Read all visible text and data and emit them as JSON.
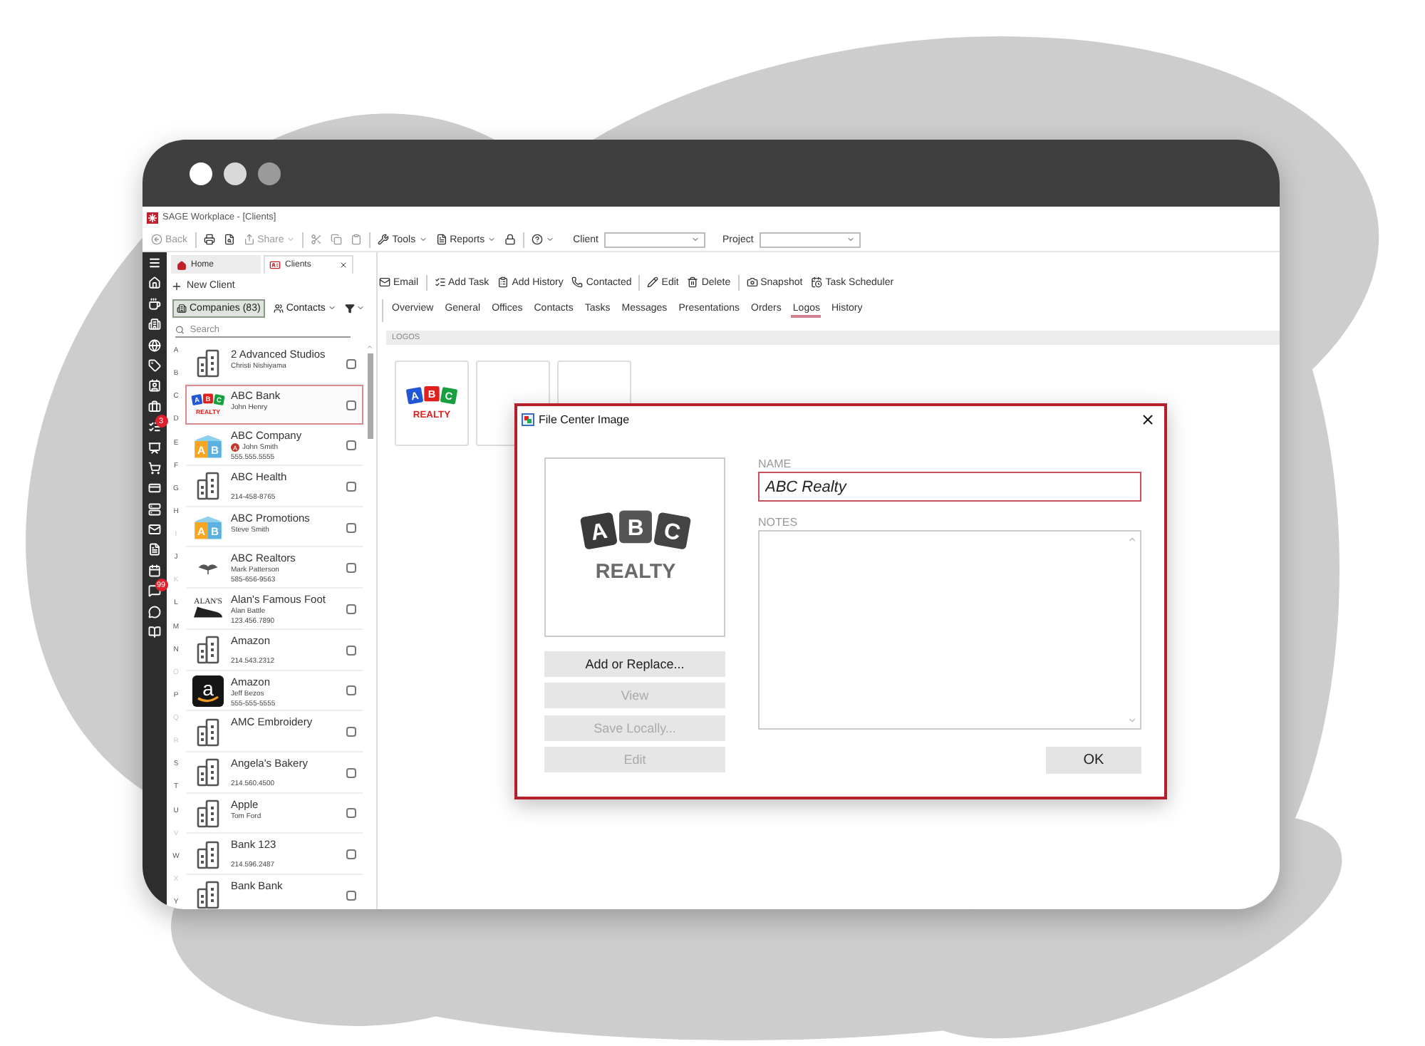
{
  "app": {
    "title": "SAGE Workplace - [Clients]"
  },
  "toolbar": [
    {
      "kind": "back",
      "label": "Back",
      "disabled": true
    },
    {
      "kind": "separator"
    },
    {
      "kind": "print",
      "disabled": false
    },
    {
      "kind": "preview",
      "disabled": false
    },
    {
      "kind": "share",
      "label": "Share",
      "caret": true,
      "disabled": true
    },
    {
      "kind": "separator"
    },
    {
      "kind": "cut",
      "disabled": true
    },
    {
      "kind": "copy",
      "disabled": true
    },
    {
      "kind": "paste",
      "disabled": true
    },
    {
      "kind": "separator"
    },
    {
      "kind": "tools",
      "label": "Tools",
      "caret": true,
      "disabled": false
    },
    {
      "kind": "reports",
      "label": "Reports",
      "caret": true,
      "disabled": false
    },
    {
      "kind": "lock",
      "disabled": false
    },
    {
      "kind": "separator"
    },
    {
      "kind": "help",
      "caret": true,
      "disabled": false
    }
  ],
  "filters": [
    {
      "label": "Client"
    },
    {
      "label": "Project"
    }
  ],
  "rail": [
    {
      "kind": "menu"
    },
    {
      "kind": "home"
    },
    {
      "kind": "cup"
    },
    {
      "kind": "building"
    },
    {
      "kind": "globe"
    },
    {
      "kind": "tag"
    },
    {
      "kind": "contact"
    },
    {
      "kind": "briefcase"
    },
    {
      "kind": "tasks",
      "badge": "3"
    },
    {
      "kind": "presentation"
    },
    {
      "kind": "cart"
    },
    {
      "kind": "card"
    },
    {
      "kind": "server"
    },
    {
      "kind": "mail"
    },
    {
      "kind": "file"
    },
    {
      "kind": "calendar"
    },
    {
      "kind": "messages",
      "badge": "99"
    },
    {
      "kind": "chat"
    },
    {
      "kind": "book"
    }
  ],
  "doc_tabs": [
    {
      "label": "Home",
      "kind": "home",
      "selected": false,
      "closable": false
    },
    {
      "label": "Clients",
      "kind": "clients",
      "selected": true,
      "closable": true
    }
  ],
  "list_pane": {
    "new_client": "New Client",
    "views": [
      {
        "label": "Companies (83)",
        "kind": "building",
        "caret": false,
        "selected": true
      },
      {
        "label": "Contacts",
        "kind": "users",
        "caret": true,
        "selected": false
      }
    ],
    "search": {
      "placeholder": "Search"
    },
    "index_letters": [
      {
        "letter": "A",
        "disabled": false
      },
      {
        "letter": "B",
        "disabled": false
      },
      {
        "letter": "C",
        "disabled": false
      },
      {
        "letter": "D",
        "disabled": false
      },
      {
        "letter": "E",
        "disabled": false
      },
      {
        "letter": "F",
        "disabled": false
      },
      {
        "letter": "G",
        "disabled": false
      },
      {
        "letter": "H",
        "disabled": false
      },
      {
        "letter": "I",
        "disabled": true
      },
      {
        "letter": "J",
        "disabled": false
      },
      {
        "letter": "K",
        "disabled": true
      },
      {
        "letter": "L",
        "disabled": false
      },
      {
        "letter": "M",
        "disabled": false
      },
      {
        "letter": "N",
        "disabled": false
      },
      {
        "letter": "O",
        "disabled": true
      },
      {
        "letter": "P",
        "disabled": false
      },
      {
        "letter": "Q",
        "disabled": true
      },
      {
        "letter": "R",
        "disabled": true
      },
      {
        "letter": "S",
        "disabled": false
      },
      {
        "letter": "T",
        "disabled": false
      },
      {
        "letter": "U",
        "disabled": false
      },
      {
        "letter": "V",
        "disabled": true
      },
      {
        "letter": "W",
        "disabled": false
      },
      {
        "letter": "X",
        "disabled": true
      },
      {
        "letter": "Y",
        "disabled": false
      }
    ],
    "clients": [
      {
        "name": "2 Advanced Studios",
        "contact": "Christi Nishiyama",
        "logo": {
          "kind": "building"
        },
        "selected": false,
        "checked": false
      },
      {
        "name": "ABC Bank",
        "contact": "John Henry",
        "logo": {
          "kind": "blocks-color",
          "letters": [
            "A",
            "B",
            "C"
          ],
          "caption": "REALTY"
        },
        "selected": true,
        "checked": false
      },
      {
        "name": "ABC Company",
        "contact": "John Smith",
        "badge": "A",
        "phone": "555.555.5555",
        "logo": {
          "kind": "toy-blocks",
          "letters": [
            "A",
            "B"
          ]
        },
        "selected": false,
        "checked": false
      },
      {
        "name": "ABC Health",
        "phone": "214-458-8765",
        "logo": {
          "kind": "building"
        },
        "selected": false,
        "checked": false
      },
      {
        "name": "ABC Promotions",
        "contact": "Steve Smith",
        "logo": {
          "kind": "toy-blocks",
          "letters": [
            "A",
            "B"
          ]
        },
        "selected": false,
        "checked": false
      },
      {
        "name": "ABC Realtors",
        "contact": "Mark Patterson",
        "phone": "585-656-9563",
        "logo": {
          "kind": "bird"
        },
        "selected": false,
        "checked": false
      },
      {
        "name": "Alan's Famous Foot",
        "contact": "Alan Battle",
        "phone": "123.456.7890",
        "logo": {
          "kind": "shoe",
          "caption": "ALAN'S"
        },
        "selected": false,
        "checked": false
      },
      {
        "name": "Amazon",
        "phone": "214.543.2312",
        "logo": {
          "kind": "building"
        },
        "selected": false,
        "checked": false
      },
      {
        "name": "Amazon",
        "contact": "Jeff Bezos",
        "phone": "555-555-5555",
        "logo": {
          "kind": "smile-tile",
          "letter": "a"
        },
        "selected": false,
        "checked": false
      },
      {
        "name": "AMC Embroidery",
        "logo": {
          "kind": "building"
        },
        "selected": false,
        "checked": false
      },
      {
        "name": "Angela's Bakery",
        "phone": "214.560.4500",
        "logo": {
          "kind": "building"
        },
        "selected": false,
        "checked": false
      },
      {
        "name": "Apple",
        "contact": "Tom Ford",
        "logo": {
          "kind": "building"
        },
        "selected": false,
        "checked": false
      },
      {
        "name": "Bank 123",
        "phone": "214.596.2487",
        "logo": {
          "kind": "building"
        },
        "selected": false,
        "checked": false
      },
      {
        "name": "Bank Bank",
        "logo": {
          "kind": "building"
        },
        "selected": false,
        "checked": false
      }
    ]
  },
  "actions": [
    {
      "kind": "email",
      "label": "Email"
    },
    {
      "kind": "separator"
    },
    {
      "kind": "task",
      "label": "Add Task"
    },
    {
      "kind": "history",
      "label": "Add History"
    },
    {
      "kind": "contacted",
      "label": "Contacted"
    },
    {
      "kind": "separator"
    },
    {
      "kind": "edit",
      "label": "Edit"
    },
    {
      "kind": "delete",
      "label": "Delete"
    },
    {
      "kind": "separator"
    },
    {
      "kind": "snapshot",
      "label": "Snapshot"
    },
    {
      "kind": "scheduler",
      "label": "Task Scheduler"
    }
  ],
  "tabs": [
    {
      "label": "Overview",
      "selected": false
    },
    {
      "label": "General",
      "selected": false
    },
    {
      "label": "Offices",
      "selected": false
    },
    {
      "label": "Contacts",
      "selected": false
    },
    {
      "label": "Tasks",
      "selected": false
    },
    {
      "label": "Messages",
      "selected": false
    },
    {
      "label": "Presentations",
      "selected": false
    },
    {
      "label": "Orders",
      "selected": false
    },
    {
      "label": "Logos",
      "selected": true
    },
    {
      "label": "History",
      "selected": false
    }
  ],
  "section": {
    "title": "LOGOS"
  },
  "logo_cards": [
    {
      "kind": "logo",
      "logo": {
        "kind": "blocks-color",
        "letters": [
          "A",
          "B",
          "C"
        ],
        "caption": "REALTY"
      }
    },
    {
      "kind": "empty"
    },
    {
      "kind": "empty"
    }
  ],
  "dialog": {
    "title": "File Center Image",
    "preview": {
      "kind": "blocks-grey",
      "letters": [
        "A",
        "B",
        "C"
      ],
      "caption": "REALTY"
    },
    "buttons": [
      {
        "label": "Add or Replace...",
        "disabled": false
      },
      {
        "label": "View",
        "disabled": true
      },
      {
        "label": "Save Locally...",
        "disabled": true
      },
      {
        "label": "Edit",
        "disabled": true
      }
    ],
    "name_field": {
      "label": "NAME",
      "value": "ABC Realty"
    },
    "notes_field": {
      "label": "NOTES"
    },
    "ok": "OK"
  }
}
